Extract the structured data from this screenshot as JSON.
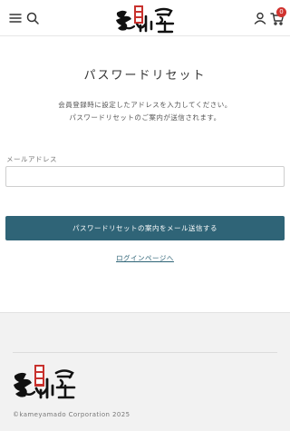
{
  "header": {
    "menu_icon": "hamburger-icon",
    "search_icon": "search-icon",
    "logo_text": "亀山堂",
    "account_icon": "user-icon",
    "cart_icon": "cart-icon",
    "cart_count": "0"
  },
  "main": {
    "title": "パスワードリセット",
    "description_line1": "会員登録時に設定したアドレスを入力してください。",
    "description_line2": "パスワードリセットのご案内が送信されます。",
    "email_label": "メールアドレス",
    "email_value": "",
    "email_placeholder": "",
    "submit_label": "パスワードリセットの案内をメール送信する",
    "login_link_label": "ログインページへ"
  },
  "footer": {
    "logo_text": "亀山堂",
    "copyright": "©kameyamado Corporation 2025"
  },
  "colors": {
    "primary_button": "#2f6477",
    "badge": "#d0332f",
    "seal_red": "#c8312d",
    "footer_bg": "#f2f2f2"
  }
}
